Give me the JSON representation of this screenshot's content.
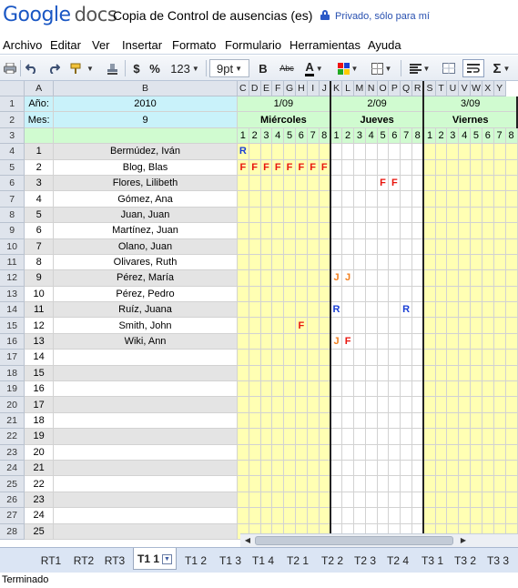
{
  "header": {
    "logo_google": "Google",
    "logo_docs": "docs",
    "doc_title": "Copia de Control de ausencias (es)",
    "privacy": "Privado, sólo para mí"
  },
  "menu": [
    "Archivo",
    "Editar",
    "Ver",
    "Insertar",
    "Formato",
    "Formulario",
    "Herramientas",
    "Ayuda"
  ],
  "toolbar": {
    "currency": "$",
    "percent": "%",
    "number_format": "123",
    "font_size": "9pt",
    "bold": "B",
    "strike": "Abc",
    "font_color": "A",
    "sum": "Σ"
  },
  "columns": {
    "headers": [
      "A",
      "B",
      "C",
      "D",
      "E",
      "F",
      "G",
      "H",
      "I",
      "J",
      "K",
      "L",
      "M",
      "N",
      "O",
      "P",
      "Q",
      "R",
      "S",
      "T",
      "U",
      "V",
      "W",
      "X",
      "Y"
    ]
  },
  "rows_meta": {
    "row_numbers": [
      "1",
      "2",
      "3",
      "4",
      "5",
      "6",
      "7",
      "8",
      "9",
      "10",
      "11",
      "12",
      "13",
      "14",
      "15",
      "16",
      "17",
      "18",
      "19",
      "20",
      "21",
      "22",
      "23",
      "24",
      "25",
      "26",
      "27",
      "28"
    ]
  },
  "sheet": {
    "year_label": "Año:",
    "year_value": "2010",
    "month_label": "Mes:",
    "month_value": "9",
    "days": [
      {
        "date": "1/09",
        "weekday": "Miércoles"
      },
      {
        "date": "2/09",
        "weekday": "Jueves"
      },
      {
        "date": "3/09",
        "weekday": "Viernes"
      }
    ],
    "slots": [
      "1",
      "2",
      "3",
      "4",
      "5",
      "6",
      "7",
      "8"
    ],
    "employees": [
      {
        "num": "1",
        "name": "Bermúdez, Iván"
      },
      {
        "num": "2",
        "name": "Blog, Blas"
      },
      {
        "num": "3",
        "name": "Flores, Lilibeth"
      },
      {
        "num": "4",
        "name": "Gómez, Ana"
      },
      {
        "num": "5",
        "name": "Juan, Juan"
      },
      {
        "num": "6",
        "name": "Martínez, Juan"
      },
      {
        "num": "7",
        "name": "Olano, Juan"
      },
      {
        "num": "8",
        "name": "Olivares, Ruth"
      },
      {
        "num": "9",
        "name": "Pérez, María"
      },
      {
        "num": "10",
        "name": "Pérez, Pedro"
      },
      {
        "num": "11",
        "name": "Ruíz, Juana"
      },
      {
        "num": "12",
        "name": "Smith, John"
      },
      {
        "num": "13",
        "name": "Wiki, Ann"
      },
      {
        "num": "14",
        "name": ""
      },
      {
        "num": "15",
        "name": ""
      },
      {
        "num": "16",
        "name": ""
      },
      {
        "num": "17",
        "name": ""
      },
      {
        "num": "18",
        "name": ""
      },
      {
        "num": "19",
        "name": ""
      },
      {
        "num": "20",
        "name": ""
      },
      {
        "num": "21",
        "name": ""
      },
      {
        "num": "22",
        "name": ""
      },
      {
        "num": "23",
        "name": ""
      },
      {
        "num": "24",
        "name": ""
      },
      {
        "num": "25",
        "name": ""
      }
    ],
    "marks": [
      {
        "emp": 0,
        "col": 0,
        "code": "R"
      },
      {
        "emp": 1,
        "col": 0,
        "code": "F"
      },
      {
        "emp": 1,
        "col": 1,
        "code": "F"
      },
      {
        "emp": 1,
        "col": 2,
        "code": "F"
      },
      {
        "emp": 1,
        "col": 3,
        "code": "F"
      },
      {
        "emp": 1,
        "col": 4,
        "code": "F"
      },
      {
        "emp": 1,
        "col": 5,
        "code": "F"
      },
      {
        "emp": 1,
        "col": 6,
        "code": "F"
      },
      {
        "emp": 1,
        "col": 7,
        "code": "F"
      },
      {
        "emp": 2,
        "col": 12,
        "code": "F"
      },
      {
        "emp": 2,
        "col": 13,
        "code": "F"
      },
      {
        "emp": 8,
        "col": 8,
        "code": "J"
      },
      {
        "emp": 8,
        "col": 9,
        "code": "J"
      },
      {
        "emp": 10,
        "col": 8,
        "code": "R"
      },
      {
        "emp": 10,
        "col": 14,
        "code": "R"
      },
      {
        "emp": 11,
        "col": 5,
        "code": "F"
      },
      {
        "emp": 12,
        "col": 8,
        "code": "J"
      },
      {
        "emp": 12,
        "col": 9,
        "code": "F"
      }
    ]
  },
  "tabs": [
    {
      "label": "RT1"
    },
    {
      "label": "RT2"
    },
    {
      "label": "RT3"
    },
    {
      "label": "T1 1",
      "active": true
    },
    {
      "label": "T1 2"
    },
    {
      "label": "T1 3"
    },
    {
      "label": "T1 4"
    },
    {
      "label": "T2 1"
    },
    {
      "label": "T2 2"
    },
    {
      "label": "T2 3"
    },
    {
      "label": "T2 4"
    },
    {
      "label": "T3 1"
    },
    {
      "label": "T3 2"
    },
    {
      "label": "T3 3"
    }
  ],
  "status": "Terminado",
  "colors": {
    "cyan_header": "#c9f2fa",
    "green_header": "#d0fbd0",
    "weekend_yellow": "#ffffb3",
    "row_grey": "#e4e4e4",
    "mark_F": "#e8150d",
    "mark_J": "#f07f1f",
    "mark_R": "#1a3fd4"
  }
}
